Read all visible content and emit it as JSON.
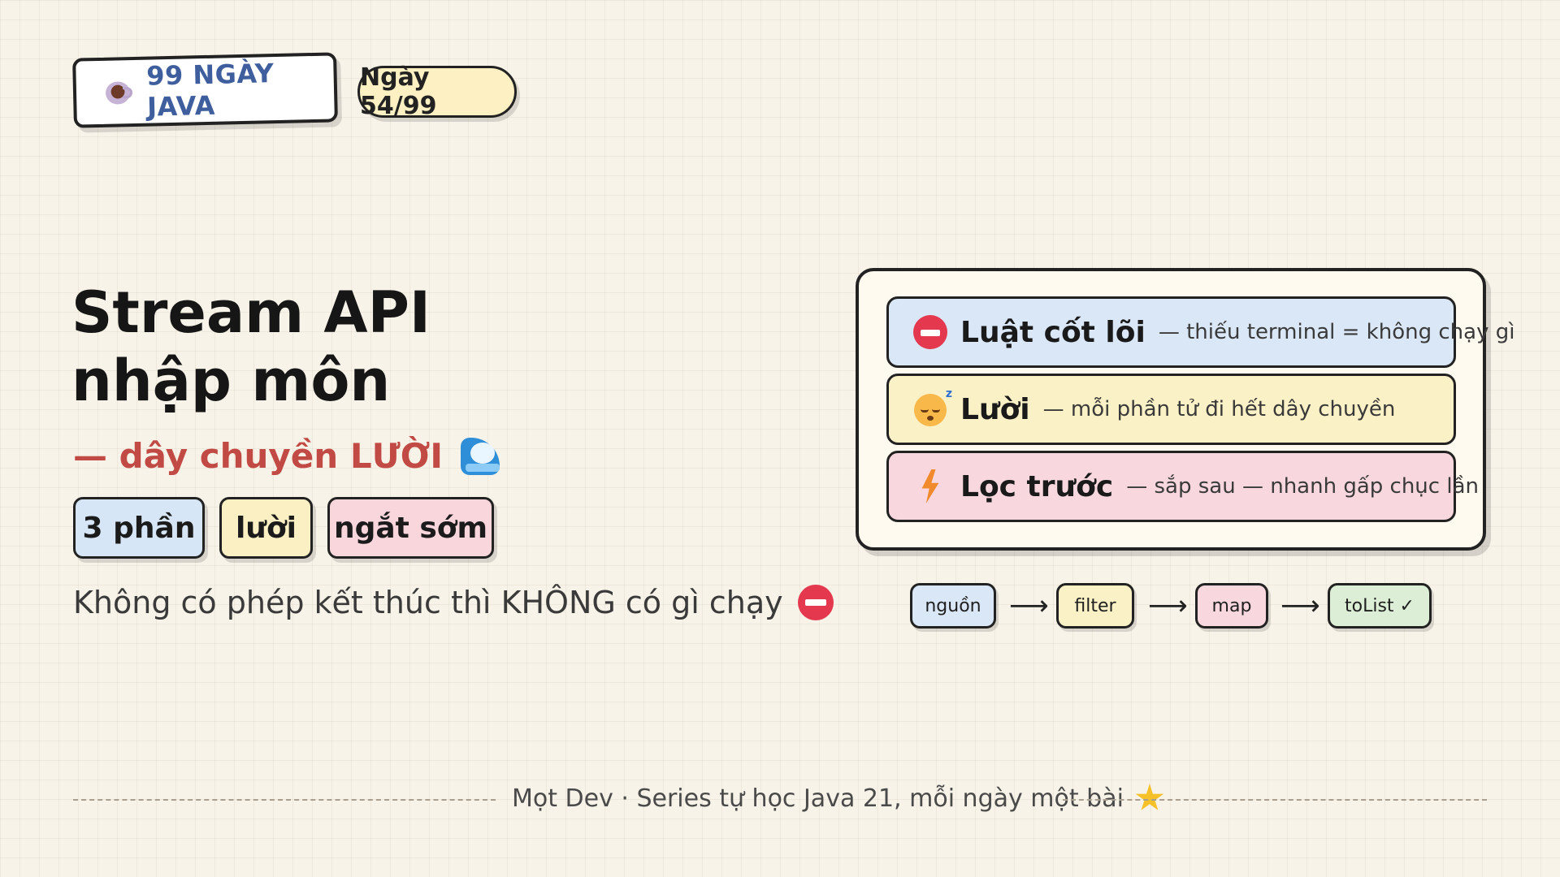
{
  "header": {
    "brand_icon": "coffee-cup-icon",
    "brand_label": "99 NGÀY JAVA",
    "day_label": "Ngày 54/99"
  },
  "hero": {
    "title_line1": "Stream API",
    "title_line2": "nhập môn",
    "subtitle": "— dây chuyền LƯỜI",
    "subtitle_icon": "wave-icon",
    "tags": [
      "3 phần",
      "lười",
      "ngắt sớm"
    ],
    "note": "Không có phép kết thúc thì KHÔNG có gì chạy",
    "note_icon": "no-entry-icon"
  },
  "rules_card": {
    "rows": [
      {
        "icon": "no-entry-icon",
        "title": "Luật cốt lõi",
        "desc": "— thiếu terminal = không chạy gì"
      },
      {
        "icon": "sleepy-face-icon",
        "title": "Lười",
        "desc": "— mỗi phần tử đi hết dây chuyền"
      },
      {
        "icon": "lightning-icon",
        "title": "Lọc trước",
        "desc": "— sắp sau — nhanh gấp chục lần"
      }
    ]
  },
  "pipeline": {
    "steps": [
      "nguồn",
      "filter",
      "map",
      "toList ✓"
    ],
    "arrow": "⟶"
  },
  "footer": {
    "text": "Mọt Dev · Series tự học Java 21, mỗi ngày một bài",
    "icon": "star-icon"
  },
  "colors": {
    "background": "#f8f3e8",
    "accent_red": "#c24a44",
    "brand_blue": "#3f5e9e",
    "blue_fill": "#d9e7f7",
    "yellow_fill": "#fbf1c6",
    "pink_fill": "#f8d8de",
    "green_fill": "#dcefd6"
  }
}
